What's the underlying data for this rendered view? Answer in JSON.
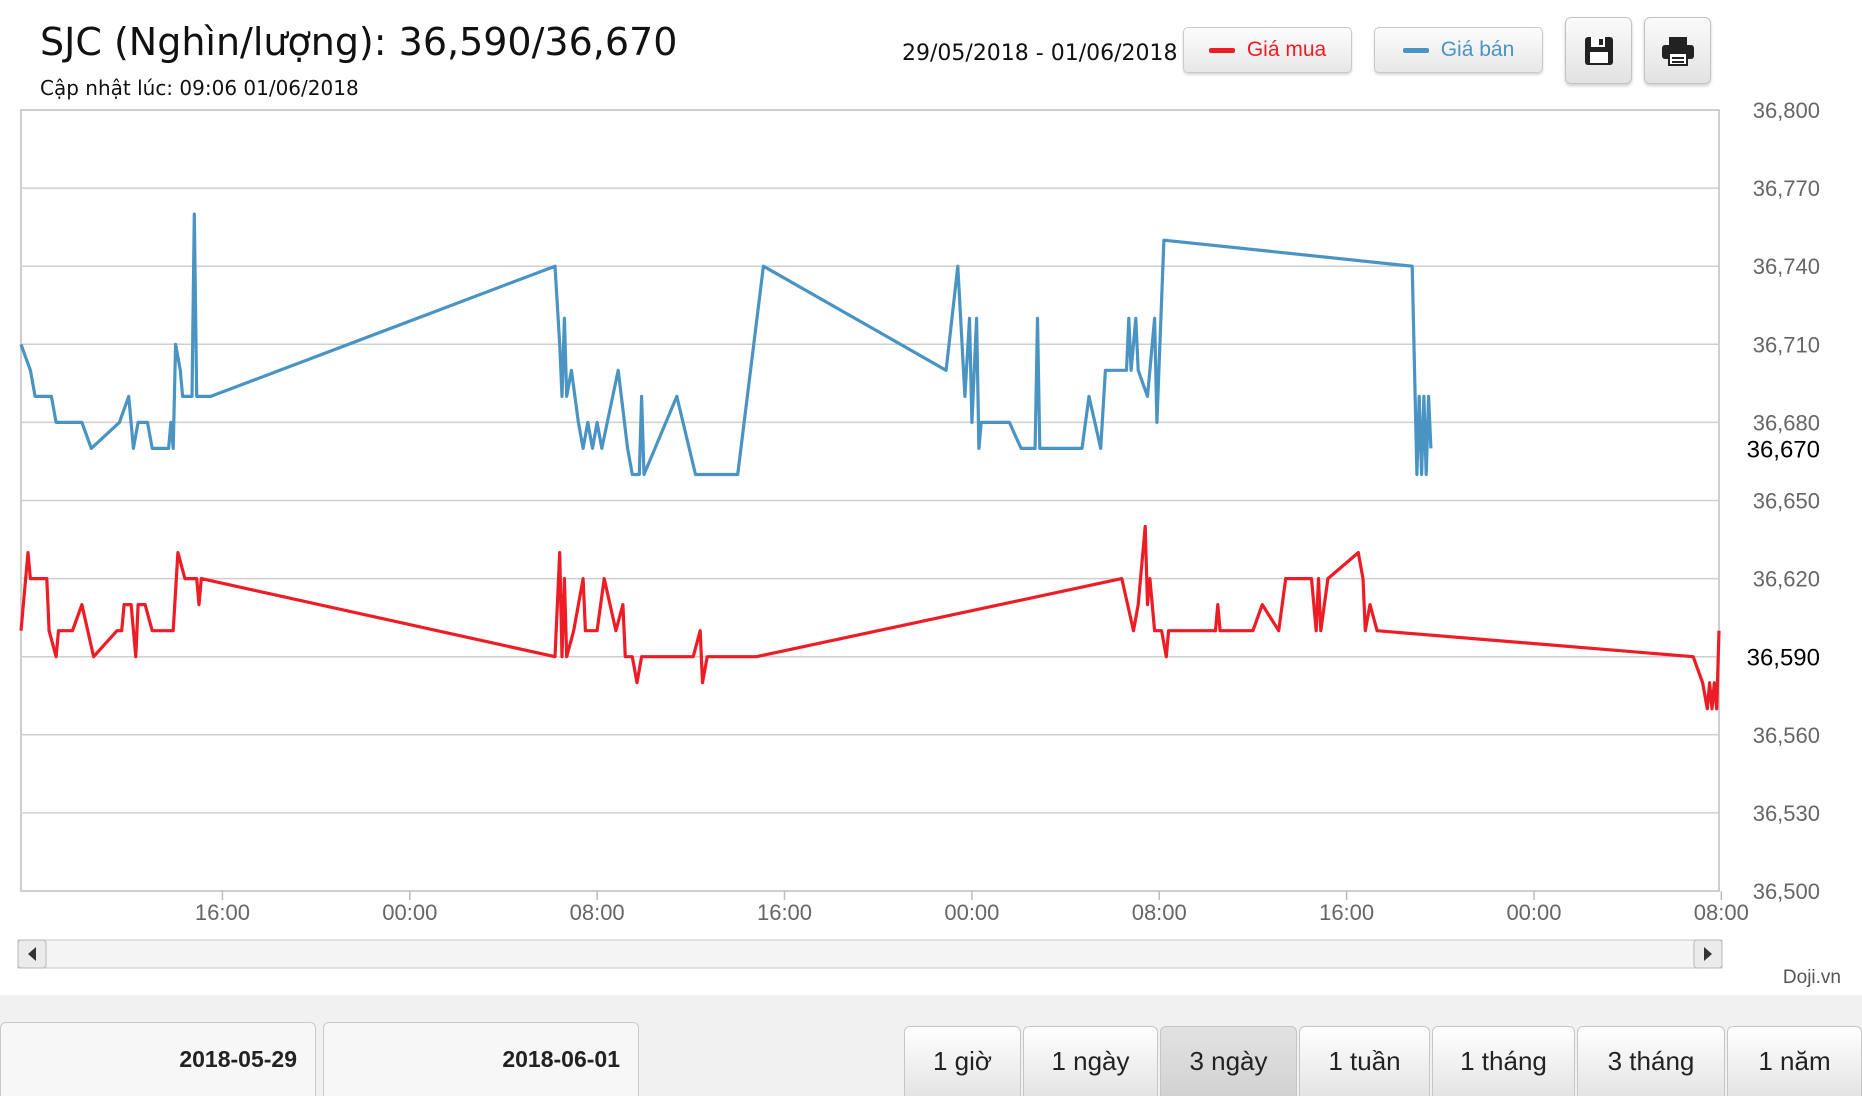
{
  "header": {
    "title": "SJC (Nghìn/lượng): 36,590/36,670",
    "updated": "Cập nhật lúc: 09:06 01/06/2018",
    "date_range": "29/05/2018 - 01/06/2018"
  },
  "legend": {
    "buy": {
      "label": "Giá mua",
      "color": "#ee1c25"
    },
    "sell": {
      "label": "Giá bán",
      "color": "#4a94c3"
    }
  },
  "toolbar": {
    "save_icon": "save-icon",
    "print_icon": "print-icon"
  },
  "watermark": "Doji.vn",
  "tabs": [
    "2018-05-29",
    "2018-06-01"
  ],
  "periods": [
    {
      "label": "1 giờ",
      "active": false
    },
    {
      "label": "1 ngày",
      "active": false
    },
    {
      "label": "3 ngày",
      "active": true
    },
    {
      "label": "1 tuần",
      "active": false
    },
    {
      "label": "1 tháng",
      "active": false
    },
    {
      "label": "3 tháng",
      "active": false
    },
    {
      "label": "1 năm",
      "active": false
    }
  ],
  "chart_data": {
    "type": "line",
    "x_unit": "hours",
    "x_range": [
      7.4,
      79.9
    ],
    "ylim": [
      36500,
      36800
    ],
    "y_ticks": [
      "36,500",
      "36,530",
      "36,560",
      "36,590",
      "36,620",
      "36,650",
      "36,680",
      "36,710",
      "36,740",
      "36,770",
      "36,800"
    ],
    "y_tick_values": [
      36500,
      36530,
      36560,
      36590,
      36620,
      36650,
      36680,
      36710,
      36740,
      36770,
      36800
    ],
    "x_ticks": [
      {
        "label": "16:00",
        "value": 16
      },
      {
        "label": "00:00",
        "value": 24
      },
      {
        "label": "08:00",
        "value": 32
      },
      {
        "label": "16:00",
        "value": 40
      },
      {
        "label": "00:00",
        "value": 48
      },
      {
        "label": "08:00",
        "value": 56
      },
      {
        "label": "16:00",
        "value": 64
      },
      {
        "label": "00:00",
        "value": 72
      },
      {
        "label": "08:00",
        "value": 80
      }
    ],
    "current_labels": [
      {
        "label": "36,670",
        "value": 36670,
        "series": "Giá bán"
      },
      {
        "label": "36,590",
        "value": 36590,
        "series": "Giá mua"
      }
    ],
    "grid": true,
    "series": [
      {
        "name": "Giá bán",
        "color": "#4a94c3",
        "points": [
          [
            7.4,
            36710
          ],
          [
            7.8,
            36700
          ],
          [
            8.0,
            36690
          ],
          [
            8.7,
            36690
          ],
          [
            8.9,
            36680
          ],
          [
            10.0,
            36680
          ],
          [
            10.4,
            36670
          ],
          [
            11.6,
            36680
          ],
          [
            12.0,
            36690
          ],
          [
            12.2,
            36670
          ],
          [
            12.4,
            36680
          ],
          [
            12.8,
            36680
          ],
          [
            13.0,
            36670
          ],
          [
            13.7,
            36670
          ],
          [
            13.8,
            36680
          ],
          [
            13.9,
            36670
          ],
          [
            14.0,
            36710
          ],
          [
            14.2,
            36700
          ],
          [
            14.3,
            36690
          ],
          [
            14.7,
            36690
          ],
          [
            14.8,
            36760
          ],
          [
            14.9,
            36690
          ],
          [
            15.5,
            36690
          ],
          [
            30.2,
            36740
          ],
          [
            30.4,
            36710
          ],
          [
            30.5,
            36690
          ],
          [
            30.6,
            36720
          ],
          [
            30.7,
            36690
          ],
          [
            30.9,
            36700
          ],
          [
            31.2,
            36680
          ],
          [
            31.4,
            36670
          ],
          [
            31.6,
            36680
          ],
          [
            31.8,
            36670
          ],
          [
            32.0,
            36680
          ],
          [
            32.2,
            36670
          ],
          [
            32.9,
            36700
          ],
          [
            33.3,
            36670
          ],
          [
            33.5,
            36660
          ],
          [
            33.8,
            36660
          ],
          [
            33.9,
            36690
          ],
          [
            34.0,
            36660
          ],
          [
            35.4,
            36690
          ],
          [
            36.2,
            36660
          ],
          [
            38.0,
            36660
          ],
          [
            39.1,
            36740
          ],
          [
            46.9,
            36700
          ],
          [
            47.4,
            36740
          ],
          [
            47.7,
            36690
          ],
          [
            47.9,
            36720
          ],
          [
            48.0,
            36680
          ],
          [
            48.2,
            36720
          ],
          [
            48.3,
            36670
          ],
          [
            48.4,
            36680
          ],
          [
            49.6,
            36680
          ],
          [
            50.1,
            36670
          ],
          [
            50.7,
            36670
          ],
          [
            50.8,
            36720
          ],
          [
            50.9,
            36670
          ],
          [
            52.7,
            36670
          ],
          [
            53.0,
            36690
          ],
          [
            53.5,
            36670
          ],
          [
            53.7,
            36700
          ],
          [
            54.6,
            36700
          ],
          [
            54.7,
            36720
          ],
          [
            54.8,
            36700
          ],
          [
            55.0,
            36720
          ],
          [
            55.1,
            36700
          ],
          [
            55.5,
            36690
          ],
          [
            55.8,
            36720
          ],
          [
            55.9,
            36680
          ],
          [
            56.2,
            36750
          ],
          [
            66.8,
            36740
          ],
          [
            67.0,
            36660
          ],
          [
            67.1,
            36690
          ],
          [
            67.2,
            36660
          ],
          [
            67.3,
            36690
          ],
          [
            67.4,
            36660
          ],
          [
            67.5,
            36690
          ],
          [
            67.6,
            36670
          ]
        ]
      },
      {
        "name": "Giá mua",
        "color": "#ee1c25",
        "points": [
          [
            7.4,
            36600
          ],
          [
            7.7,
            36630
          ],
          [
            7.8,
            36620
          ],
          [
            8.5,
            36620
          ],
          [
            8.6,
            36600
          ],
          [
            8.9,
            36590
          ],
          [
            9.0,
            36600
          ],
          [
            9.6,
            36600
          ],
          [
            10.0,
            36610
          ],
          [
            10.5,
            36590
          ],
          [
            11.5,
            36600
          ],
          [
            11.7,
            36600
          ],
          [
            11.8,
            36610
          ],
          [
            12.1,
            36610
          ],
          [
            12.3,
            36590
          ],
          [
            12.4,
            36610
          ],
          [
            12.7,
            36610
          ],
          [
            13.0,
            36600
          ],
          [
            13.9,
            36600
          ],
          [
            14.1,
            36630
          ],
          [
            14.4,
            36620
          ],
          [
            14.9,
            36620
          ],
          [
            15.0,
            36610
          ],
          [
            15.1,
            36620
          ],
          [
            30.2,
            36590
          ],
          [
            30.4,
            36630
          ],
          [
            30.5,
            36590
          ],
          [
            30.6,
            36620
          ],
          [
            30.7,
            36590
          ],
          [
            31.0,
            36600
          ],
          [
            31.4,
            36620
          ],
          [
            31.5,
            36600
          ],
          [
            32.0,
            36600
          ],
          [
            32.3,
            36620
          ],
          [
            32.8,
            36600
          ],
          [
            33.1,
            36610
          ],
          [
            33.2,
            36590
          ],
          [
            33.5,
            36590
          ],
          [
            33.7,
            36580
          ],
          [
            33.9,
            36590
          ],
          [
            36.1,
            36590
          ],
          [
            36.4,
            36600
          ],
          [
            36.5,
            36580
          ],
          [
            36.7,
            36590
          ],
          [
            38.8,
            36590
          ],
          [
            54.4,
            36620
          ],
          [
            54.9,
            36600
          ],
          [
            55.1,
            36610
          ],
          [
            55.4,
            36640
          ],
          [
            55.5,
            36610
          ],
          [
            55.6,
            36620
          ],
          [
            55.8,
            36600
          ],
          [
            56.1,
            36600
          ],
          [
            56.3,
            36590
          ],
          [
            56.4,
            36600
          ],
          [
            58.4,
            36600
          ],
          [
            58.5,
            36610
          ],
          [
            58.6,
            36600
          ],
          [
            60.0,
            36600
          ],
          [
            60.4,
            36610
          ],
          [
            61.1,
            36600
          ],
          [
            61.4,
            36620
          ],
          [
            62.5,
            36620
          ],
          [
            62.7,
            36600
          ],
          [
            62.8,
            36620
          ],
          [
            62.9,
            36600
          ],
          [
            63.2,
            36620
          ],
          [
            64.5,
            36630
          ],
          [
            64.7,
            36620
          ],
          [
            64.8,
            36600
          ],
          [
            65.0,
            36610
          ],
          [
            65.3,
            36600
          ],
          [
            78.8,
            36590
          ],
          [
            79.2,
            36580
          ],
          [
            79.4,
            36570
          ],
          [
            79.5,
            36580
          ],
          [
            79.6,
            36570
          ],
          [
            79.7,
            36580
          ],
          [
            79.8,
            36570
          ],
          [
            79.9,
            36600
          ]
        ]
      }
    ]
  }
}
